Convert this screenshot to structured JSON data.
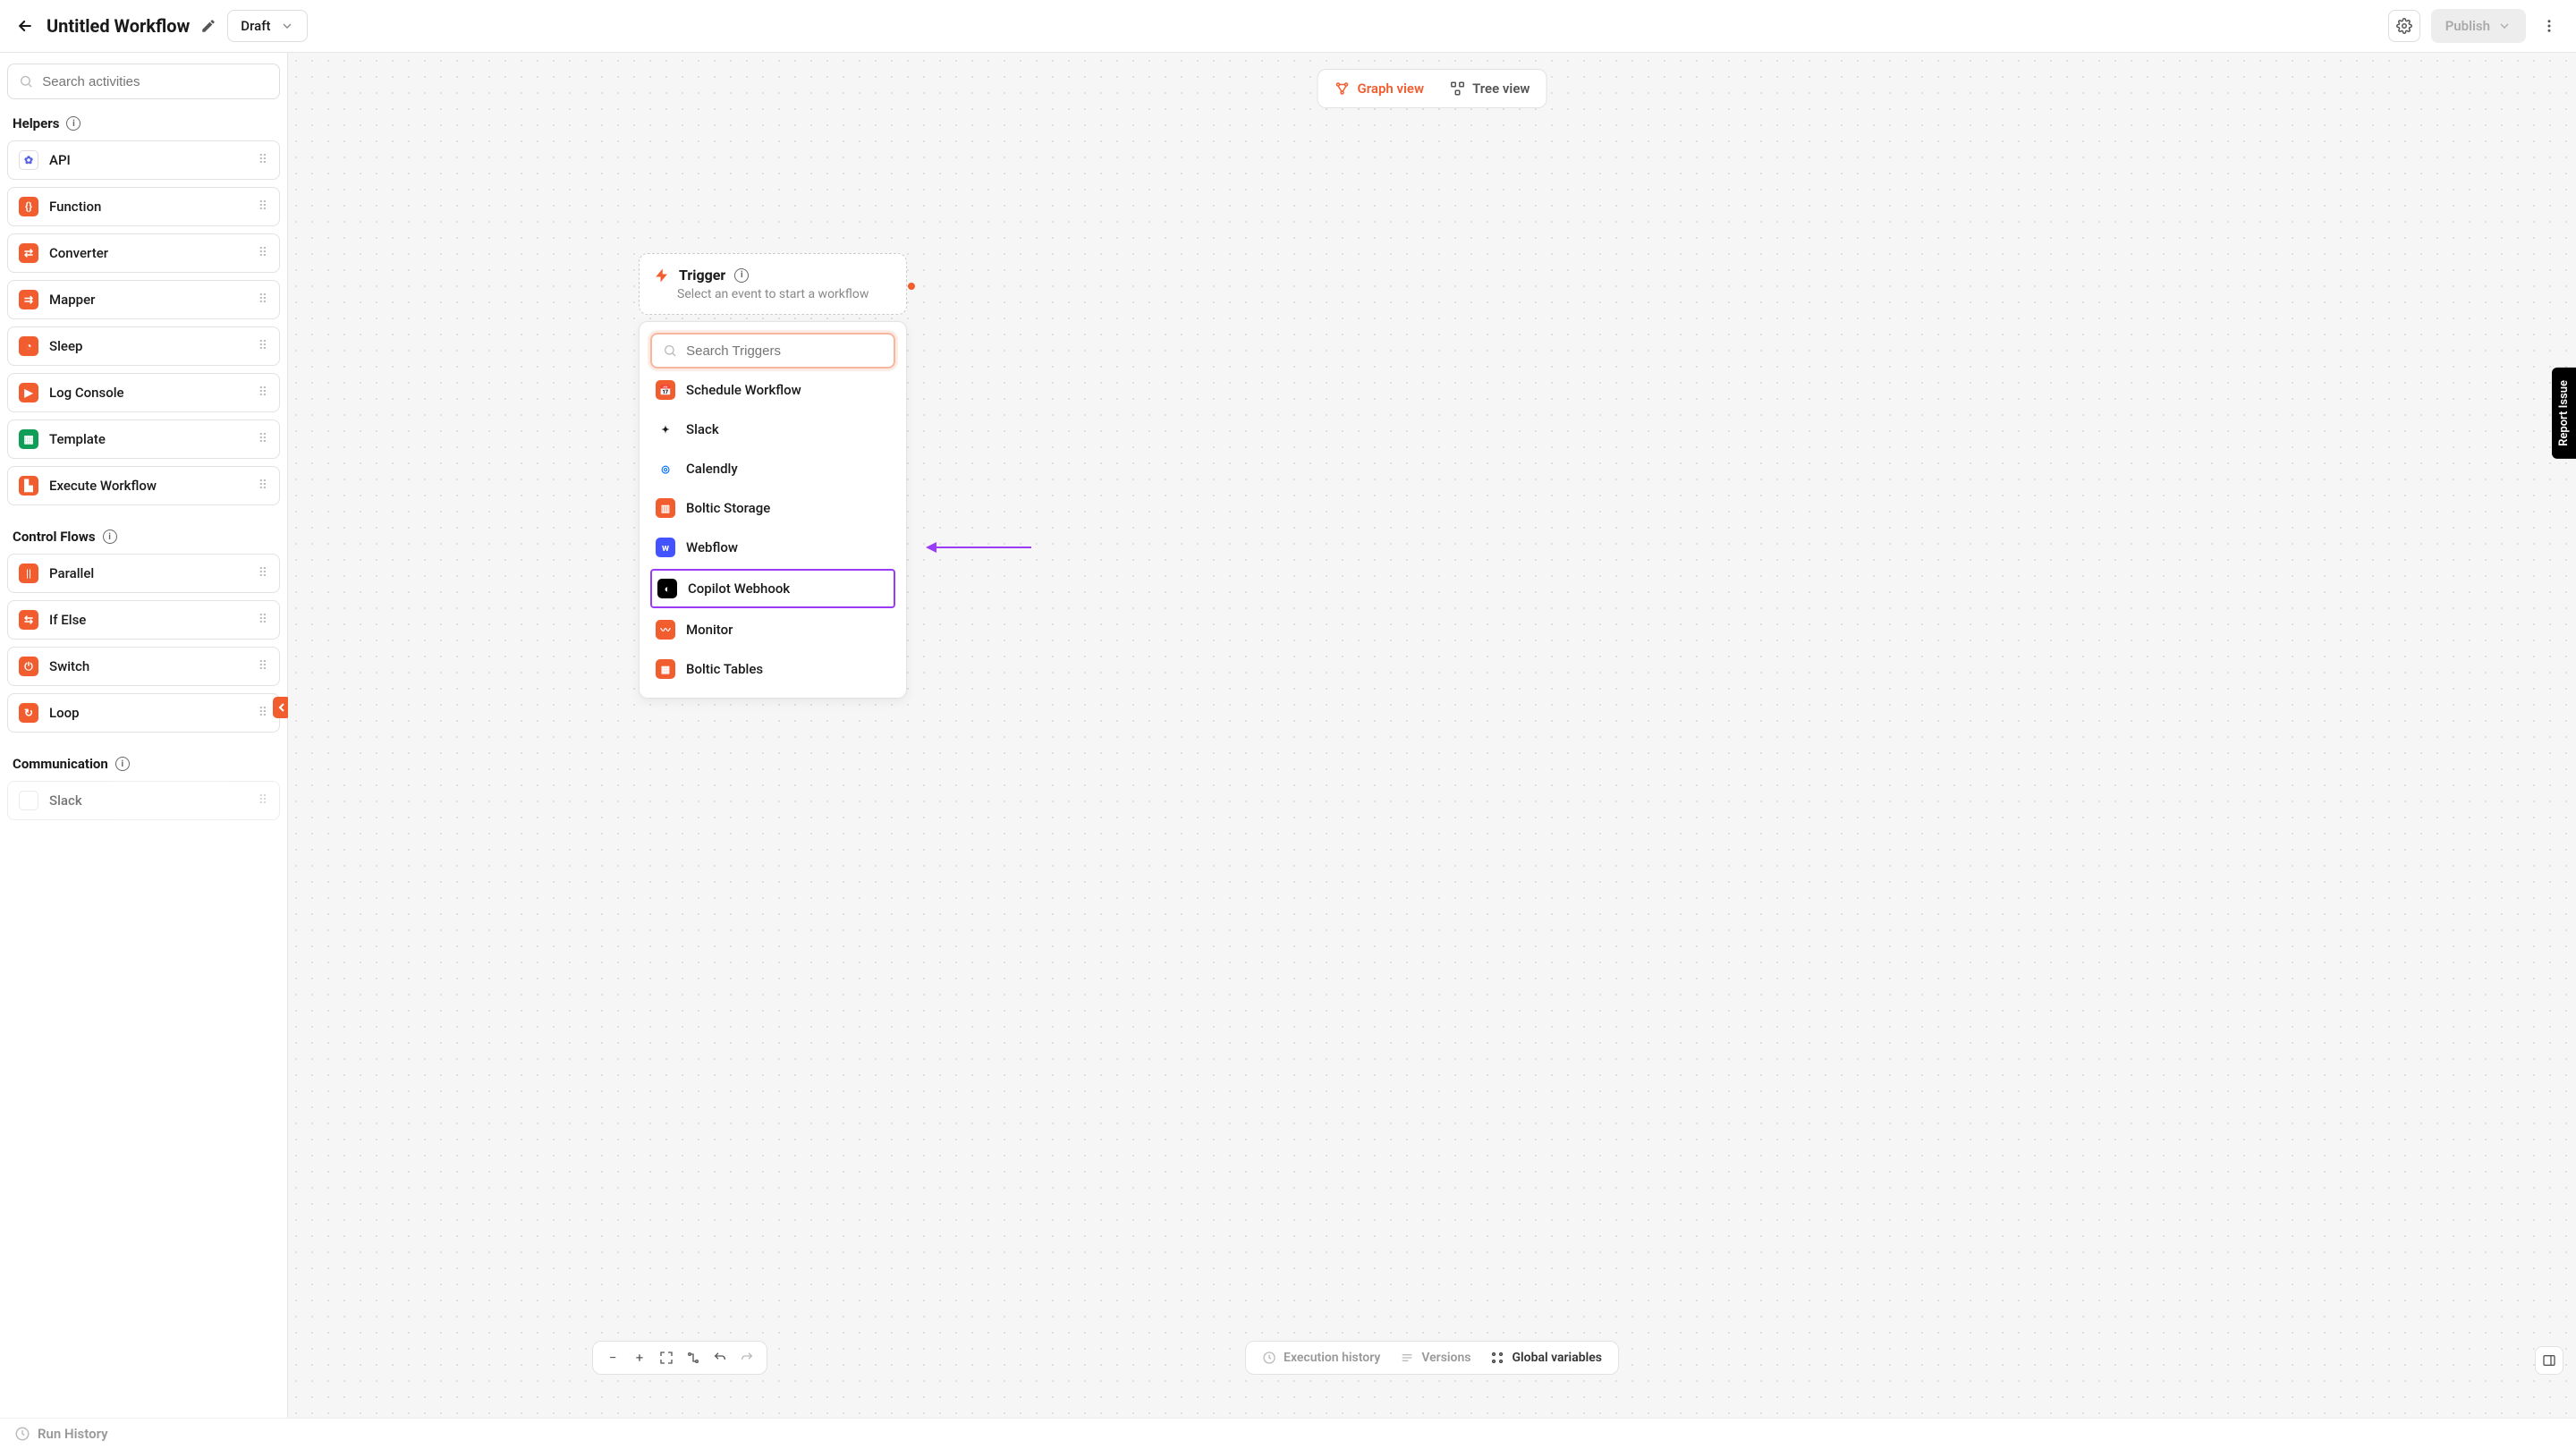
{
  "header": {
    "title": "Untitled Workflow",
    "status": "Draft",
    "publish_label": "Publish"
  },
  "sidebar": {
    "search_placeholder": "Search activities",
    "sections": {
      "helpers": {
        "title": "Helpers"
      },
      "control_flows": {
        "title": "Control Flows"
      },
      "communication": {
        "title": "Communication"
      }
    },
    "helpers_items": [
      {
        "label": "API",
        "icon": "gear"
      },
      {
        "label": "Function",
        "icon": "orange"
      },
      {
        "label": "Converter",
        "icon": "orange"
      },
      {
        "label": "Mapper",
        "icon": "orange"
      },
      {
        "label": "Sleep",
        "icon": "orange"
      },
      {
        "label": "Log Console",
        "icon": "orange"
      },
      {
        "label": "Template",
        "icon": "green"
      },
      {
        "label": "Execute Workflow",
        "icon": "orange"
      }
    ],
    "control_items": [
      {
        "label": "Parallel"
      },
      {
        "label": "If Else"
      },
      {
        "label": "Switch"
      },
      {
        "label": "Loop"
      }
    ],
    "comm_items": [
      {
        "label": "Slack"
      }
    ]
  },
  "canvas": {
    "view_tabs": {
      "graph": "Graph view",
      "tree": "Tree view"
    },
    "trigger": {
      "title": "Trigger",
      "subtitle": "Select an event to start a workflow"
    },
    "trigger_search_placeholder": "Search Triggers",
    "trigger_options": [
      {
        "label": "Schedule Workflow",
        "icon": "schedule",
        "color": "#f15d2f"
      },
      {
        "label": "Slack",
        "icon": "slack",
        "color": "#E01E5A"
      },
      {
        "label": "Calendly",
        "icon": "calendly",
        "color": "#006BFF"
      },
      {
        "label": "Boltic Storage",
        "icon": "storage",
        "color": "#f15d2f"
      },
      {
        "label": "Webflow",
        "icon": "webflow",
        "color": "#4353FF"
      },
      {
        "label": "Copilot Webhook",
        "icon": "copilot",
        "color": "#000",
        "highlight": true
      },
      {
        "label": "Monitor",
        "icon": "monitor",
        "color": "#f15d2f"
      },
      {
        "label": "Boltic Tables",
        "icon": "tables",
        "color": "#f15d2f"
      }
    ],
    "bottom_bar": {
      "exec_history": "Execution history",
      "versions": "Versions",
      "global_vars": "Global variables"
    },
    "report_issue": "Report Issue"
  },
  "footer": {
    "run_history": "Run History"
  }
}
